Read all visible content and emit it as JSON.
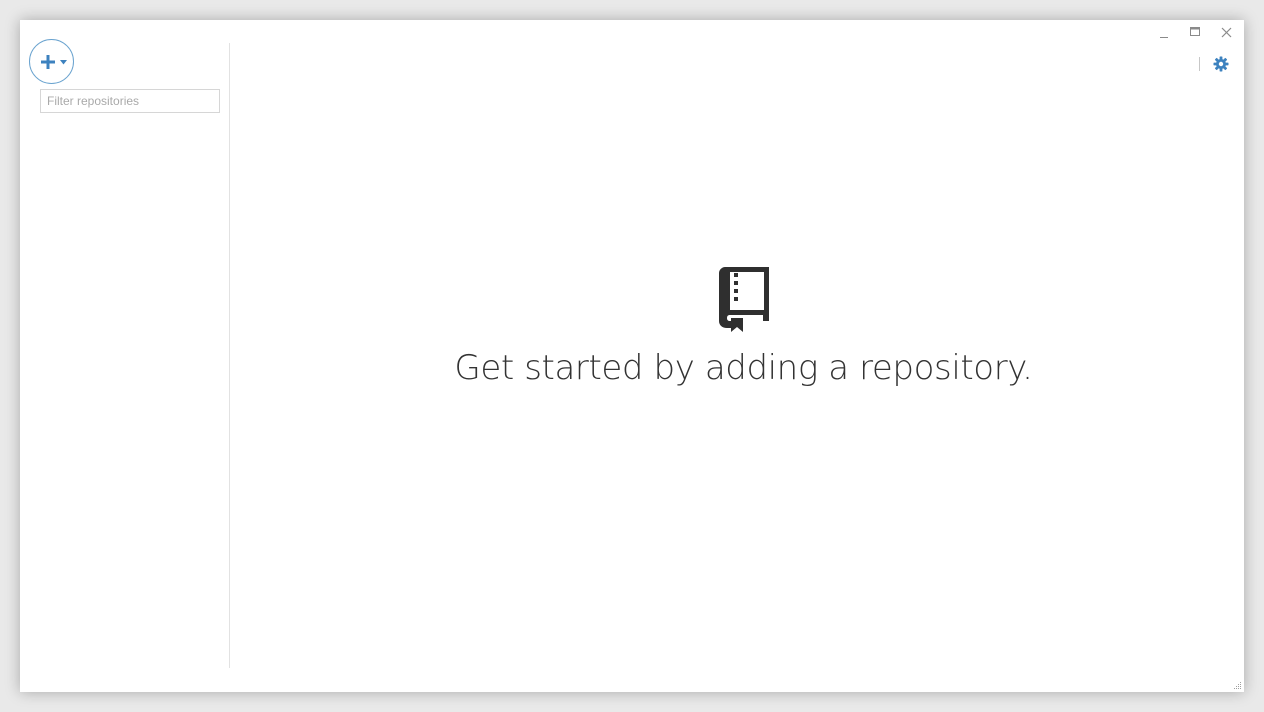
{
  "sidebar": {
    "add_button_icon": "plus-icon",
    "add_button_caret": "caret-down-icon",
    "filter": {
      "placeholder": "Filter repositories",
      "value": ""
    }
  },
  "window_controls": {
    "minimize_icon": "minimize-icon",
    "maximize_icon": "maximize-icon",
    "close_icon": "close-icon"
  },
  "toolbar": {
    "settings_icon": "gear-icon"
  },
  "empty_state": {
    "icon": "repository-book-icon",
    "message": "Get started by adding a repository."
  },
  "colors": {
    "accent": "#4a8cc4",
    "text": "#333333",
    "icon_dark": "#2f2f2f"
  }
}
